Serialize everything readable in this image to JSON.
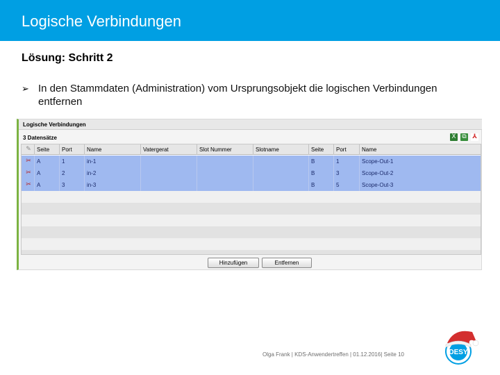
{
  "slide": {
    "title": "Logische Verbindungen",
    "subtitle": "Lösung: Schritt 2",
    "bullet_icon": "arrow-bullet-icon",
    "bullet_text": "In den Stammdaten (Administration) vom Ursprungsobjekt die logischen Verbindungen entfernen",
    "footer": "Olga Frank | KDS-Anwendertreffen | 01.12.2016| Seite 10",
    "accent_color": "#009fe3"
  },
  "panel": {
    "title": "Logische Verbindungen",
    "record_count": "3 Datensätze",
    "toolbar_icons": [
      "excel-export-icon",
      "copy-icon",
      "pdf-export-icon"
    ],
    "columns": [
      "Seite",
      "Port",
      "Name",
      "Vatergerat",
      "Slot Nummer",
      "Slotname",
      "Seite",
      "Port",
      "Name"
    ],
    "rows": [
      [
        "A",
        "1",
        "in-1",
        "",
        "",
        "",
        "B",
        "1",
        "Scope-Out-1"
      ],
      [
        "A",
        "2",
        "in-2",
        "",
        "",
        "",
        "B",
        "3",
        "Scope-Out-2"
      ],
      [
        "A",
        "3",
        "in-3",
        "",
        "",
        "",
        "B",
        "5",
        "Scope-Out-3"
      ]
    ],
    "selected_row_color": "#9fb9f0",
    "buttons": {
      "add": "Hinzufügen",
      "remove": "Entfernen"
    }
  },
  "logo": {
    "text": "DESY",
    "icon": "desy-logo-with-santa-hat"
  }
}
